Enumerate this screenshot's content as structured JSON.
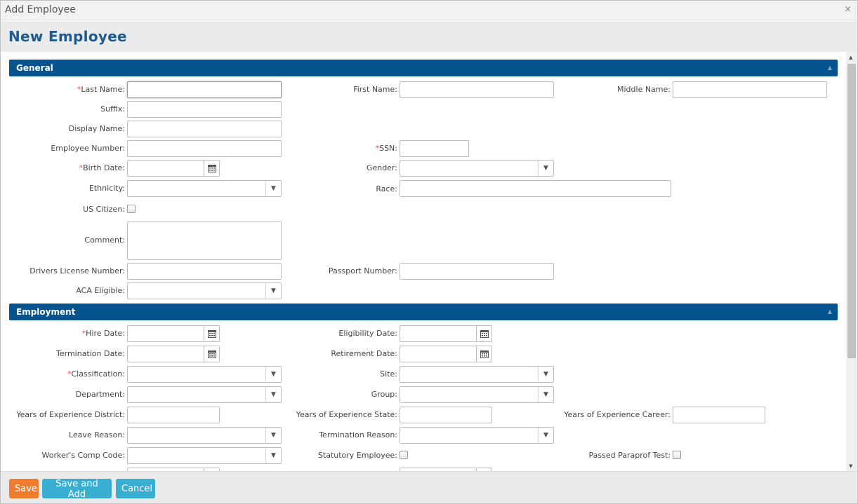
{
  "window": {
    "title": "Add Employee",
    "close_glyph": "×"
  },
  "page_title": "New Employee",
  "sections": {
    "general": "General",
    "employment": "Employment",
    "collapse_glyph": "▲"
  },
  "required_mark": "*",
  "general": {
    "last_name": "Last Name:",
    "first_name": "First Name:",
    "middle_name": "Middle Name:",
    "suffix": "Suffix:",
    "display_name": "Display Name:",
    "employee_number": "Employee Number:",
    "ssn": "SSN:",
    "birth_date": "Birth Date:",
    "gender": "Gender:",
    "ethnicity": "Ethnicity:",
    "race": "Race:",
    "us_citizen": "US Citizen:",
    "comment": "Comment:",
    "drivers_license": "Drivers License Number:",
    "passport": "Passport Number:",
    "aca_eligible": "ACA Eligible:"
  },
  "employment": {
    "hire_date": "Hire Date:",
    "eligibility_date": "Eligibility Date:",
    "termination_date": "Termination Date:",
    "retirement_date": "Retirement Date:",
    "classification": "Classification:",
    "site": "Site:",
    "department": "Department:",
    "group": "Group:",
    "yoe_district": "Years of Experience District:",
    "yoe_state": "Years of Experience State:",
    "yoe_career": "Years of Experience Career:",
    "leave_reason": "Leave Reason:",
    "termination_reason": "Termination Reason:",
    "workers_comp": "Worker's Comp Code:",
    "statutory": "Statutory Employee:",
    "paraprof": "Passed Paraprof Test:"
  },
  "dropdown_arrow": "▼",
  "footer": {
    "save": "Save",
    "save_and_add": "Save and Add",
    "cancel": "Cancel"
  },
  "colors": {
    "section_bar": "#06548f",
    "title": "#1f5b8f",
    "save": "#f07d2e",
    "secondary": "#3aaed0",
    "required": "#d9534f"
  }
}
